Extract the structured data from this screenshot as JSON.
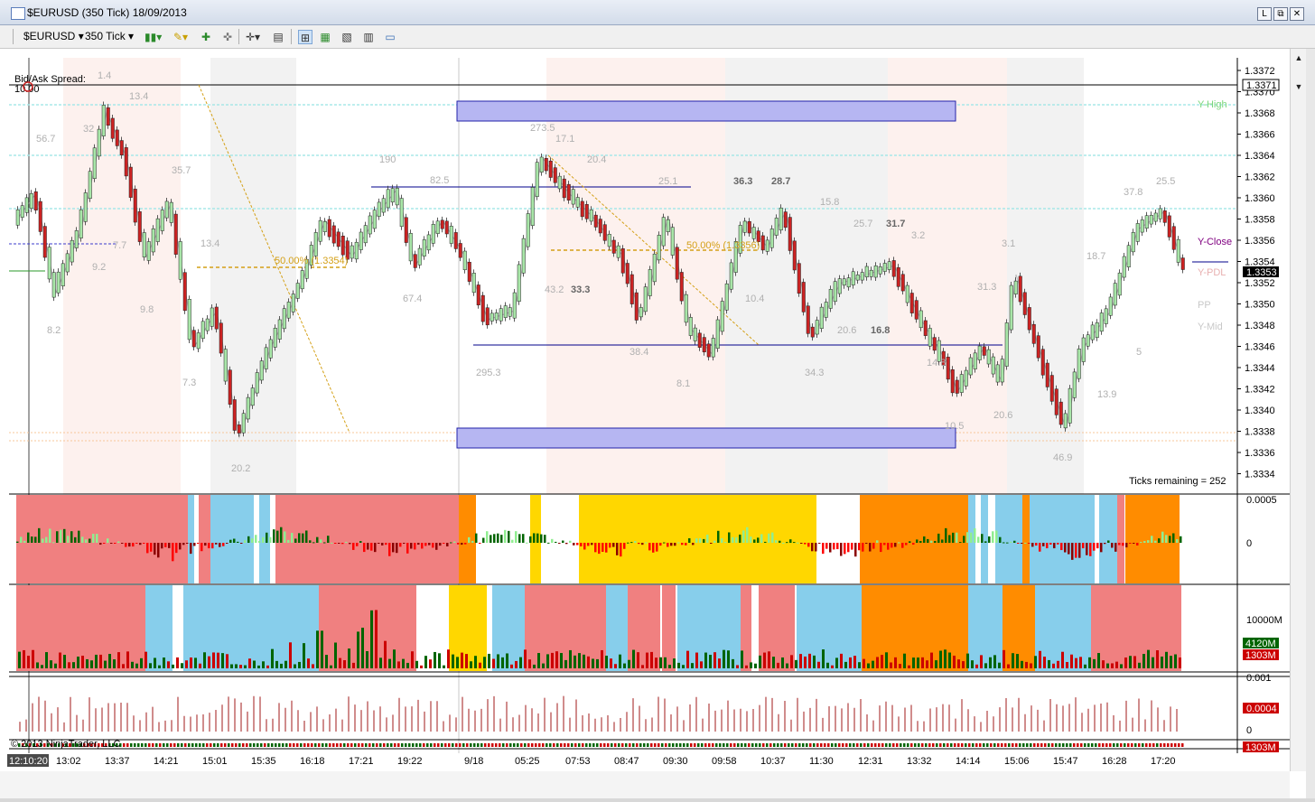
{
  "window": {
    "title": "$EURUSD (350 Tick)  18/09/2013",
    "buttons": [
      "L",
      "⧉",
      "✕"
    ]
  },
  "toolbar": {
    "instrument": "$EURUSD",
    "interval": "350 Tick"
  },
  "main_panel": {
    "bid_ask_label": "Bid/Ask Spread:",
    "bid_ask_value": "10.00",
    "ticks_remaining": "Ticks remaining = 252",
    "fib_labels": [
      "50.00% (1.3354)",
      "50.00% (1.3356)"
    ],
    "level_labels": {
      "y_high": "Y-High",
      "y_close": "Y-Close",
      "y_pdl": "Y-PDL",
      "pp": "PP",
      "y_mid": "Y-Mid"
    },
    "price_axis_ticks": [
      "1.3372",
      "1.3370",
      "1.3368",
      "1.3366",
      "1.3364",
      "1.3362",
      "1.3360",
      "1.3358",
      "1.3356",
      "1.3354",
      "1.3352",
      "1.3350",
      "1.3348",
      "1.3346",
      "1.3344",
      "1.3342",
      "1.3340",
      "1.3338",
      "1.3336",
      "1.3334"
    ],
    "price_boxes": [
      "1.3371",
      "1.3353"
    ],
    "volume_annotations": [
      {
        "t": "1.4"
      },
      {
        "t": "13.4"
      },
      {
        "t": "32"
      },
      {
        "t": "56.7"
      },
      {
        "t": "35.7"
      },
      {
        "t": "7.7"
      },
      {
        "t": "9.2"
      },
      {
        "t": "9.8"
      },
      {
        "t": "8.2"
      },
      {
        "t": "13.4"
      },
      {
        "t": "7.3"
      },
      {
        "t": "20.2"
      },
      {
        "t": "190"
      },
      {
        "t": "82.5"
      },
      {
        "t": "67.4"
      },
      {
        "t": "273.5"
      },
      {
        "t": "17.1"
      },
      {
        "t": "20.4"
      },
      {
        "t": "43.2"
      },
      {
        "t": "33.3"
      },
      {
        "t": "295.3"
      },
      {
        "t": "25.1"
      },
      {
        "t": "38.4"
      },
      {
        "t": "36.3"
      },
      {
        "t": "28.7"
      },
      {
        "t": "15.8"
      },
      {
        "t": "10.4"
      },
      {
        "t": "8.1"
      },
      {
        "t": "25.7"
      },
      {
        "t": "31.7"
      },
      {
        "t": "3.2"
      },
      {
        "t": "20.6"
      },
      {
        "t": "16.8"
      },
      {
        "t": "34.3"
      },
      {
        "t": "14.8"
      },
      {
        "t": "3.1"
      },
      {
        "t": "31.3"
      },
      {
        "t": "18.7"
      },
      {
        "t": "37.8"
      },
      {
        "t": "25.5"
      },
      {
        "t": "13.9"
      },
      {
        "t": "5"
      },
      {
        "t": "20.6"
      },
      {
        "t": "46.9"
      },
      {
        "t": "10.5"
      }
    ]
  },
  "panel2": {
    "axis": [
      "0.0005",
      "0"
    ]
  },
  "panel3": {
    "axis": [
      "10000M"
    ],
    "boxes": [
      "4120M",
      "1303M"
    ]
  },
  "panel4": {
    "axis": [
      "0.001",
      "0"
    ],
    "box": "0.0004"
  },
  "panel5": {
    "copyright": "© 2013 NinjaTrader, LLC",
    "box": "1303M"
  },
  "time_axis": [
    "12:10:20",
    "13:02",
    "13:37",
    "14:21",
    "15:01",
    "15:35",
    "16:18",
    "17:21",
    "19:22",
    "9/18",
    "05:25",
    "07:53",
    "08:47",
    "09:30",
    "09:58",
    "10:37",
    "11:30",
    "12:31",
    "13:32",
    "14:14",
    "15:06",
    "15:47",
    "16:28",
    "17:20"
  ],
  "colors": {
    "up": "#a8e6a8",
    "down": "#cc2222",
    "box": "#b6b6f2",
    "zone_red": "#f08080",
    "zone_blue": "#87ceeb",
    "zone_orange": "#ff8c00",
    "zone_yellow": "#ffd700",
    "level_cyan": "#a8e8e8",
    "fib": "#d4a017"
  }
}
